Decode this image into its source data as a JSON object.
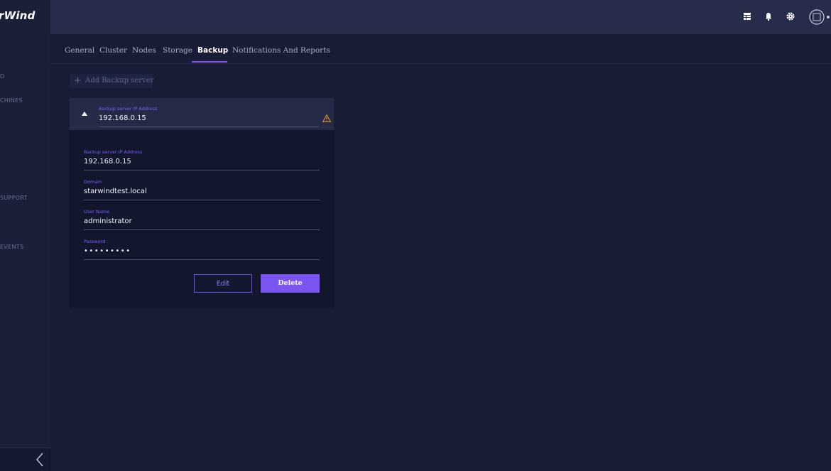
{
  "app": {
    "logo_text": "rWind"
  },
  "sidebar": {
    "items": [
      {
        "label": "D"
      },
      {
        "label": "CHINES"
      },
      {
        "label": "SUPPORT"
      },
      {
        "label": "EVENTS"
      }
    ],
    "collapse_icon": "chevron-left-icon"
  },
  "header": {
    "icons": [
      "table-icon",
      "bell-icon",
      "gear-icon",
      "avatar-icon"
    ]
  },
  "tabs": [
    {
      "label": "General"
    },
    {
      "label": "Cluster"
    },
    {
      "label": "Nodes"
    },
    {
      "label": "Storage"
    },
    {
      "label": "Backup",
      "active": true
    },
    {
      "label": "Notifications And Reports"
    }
  ],
  "backup": {
    "add_label": "Add Backup server",
    "card": {
      "header_label": "Backup server IP Address",
      "header_value": "192.168.0.15",
      "warning_icon": "warning-icon",
      "fields": [
        {
          "label": "Backup server IP Address",
          "value": "192.168.0.15"
        },
        {
          "label": "Domain",
          "value": "starwindtest.local"
        },
        {
          "label": "User Name",
          "value": "administrator"
        },
        {
          "label": "Password",
          "value": "•••••••••"
        }
      ],
      "edit_label": "Edit",
      "delete_label": "Delete"
    }
  },
  "colors": {
    "background": "#181d35",
    "header": "#262c4a",
    "accent": "#7b55f2",
    "label": "#7c5cff",
    "warning": "#e0902c"
  }
}
